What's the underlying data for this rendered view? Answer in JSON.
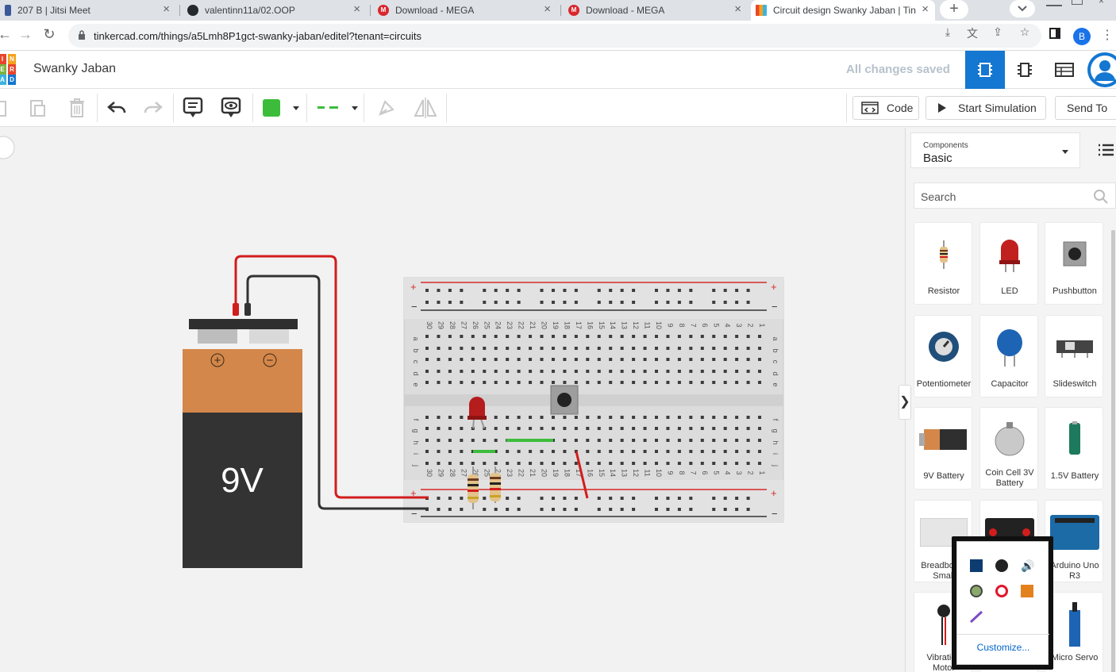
{
  "browser": {
    "tabs": [
      {
        "title": "207 B | Jitsi Meet"
      },
      {
        "title": "valentinn11a/02.OOP"
      },
      {
        "title": "Download - MEGA"
      },
      {
        "title": "Download - MEGA"
      },
      {
        "title": "Circuit design Swanky Jaban | Tin"
      }
    ],
    "tab_close_glyph": "×",
    "newtab_glyph": "+",
    "mega_letter": "M",
    "url": "tinkercad.com/things/a5Lmh8P1gct-swanky-jaban/editel?tenant=circuits",
    "profile_initial": "B"
  },
  "app": {
    "logo_letters": [
      "I",
      "N",
      "E",
      "R",
      "A",
      "D"
    ],
    "project_title": "Swanky Jaban",
    "save_status": "All changes saved",
    "active_view": "circuit"
  },
  "toolbar": {
    "code_label": "Code",
    "start_simulation_label": "Start Simulation",
    "send_to_label": "Send To",
    "color_value": "#3dbc3c"
  },
  "battery": {
    "label": "9V",
    "plus": "+",
    "minus": "−"
  },
  "breadboard": {
    "top_rail_plus": "+",
    "top_rail_minus": "−",
    "bottom_rail_plus": "+",
    "bottom_rail_minus": "−",
    "row_letters_top": [
      "a",
      "b",
      "c",
      "d",
      "e"
    ],
    "row_letters_bottom": [
      "f",
      "g",
      "h",
      "i",
      "j"
    ],
    "column_numbers": [
      "30",
      "29",
      "28",
      "27",
      "26",
      "25",
      "24",
      "23",
      "22",
      "21",
      "20",
      "19",
      "18",
      "17",
      "16",
      "15",
      "14",
      "13",
      "12",
      "11",
      "10",
      "9",
      "8",
      "7",
      "6",
      "5",
      "4",
      "3",
      "2",
      "1"
    ]
  },
  "sidebar": {
    "components_label": "Components",
    "components_value": "Basic",
    "search_placeholder": "Search",
    "collapse_glyph": "❯",
    "items": [
      {
        "label": "Resistor"
      },
      {
        "label": "LED"
      },
      {
        "label": "Pushbutton"
      },
      {
        "label": "Potentiometer"
      },
      {
        "label": "Capacitor"
      },
      {
        "label": "Slideswitch"
      },
      {
        "label": "9V Battery"
      },
      {
        "label": "Coin Cell 3V Battery"
      },
      {
        "label": "1.5V Battery"
      },
      {
        "label": "Breadboard Small"
      },
      {
        "label": "micro:bit"
      },
      {
        "label": "Arduino Uno R3"
      },
      {
        "label": "Vibration Motor"
      },
      {
        "label": ""
      },
      {
        "label": "Micro Servo"
      }
    ]
  },
  "tray": {
    "customize_label": "Customize..."
  }
}
